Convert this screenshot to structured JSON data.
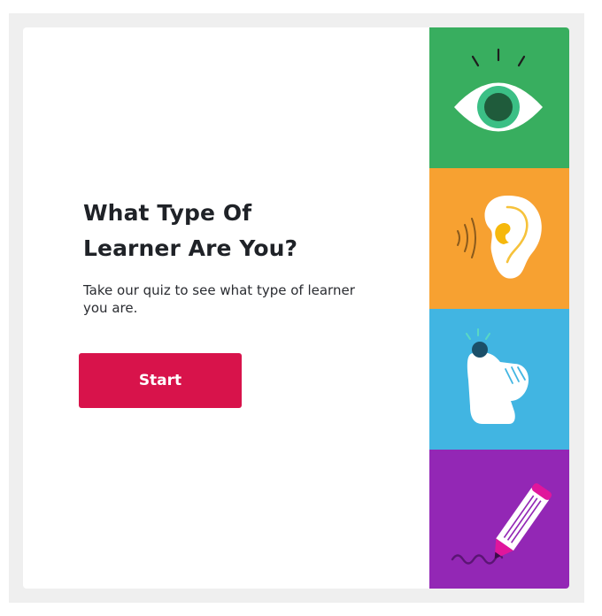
{
  "quiz": {
    "title_line1": "What Type Of",
    "title_line2": "Learner Are You?",
    "subtitle": "Take our quiz to see what type of learner you are.",
    "start_label": "Start"
  },
  "learner_types": [
    {
      "icon": "eye-icon",
      "color": "#38ae5f"
    },
    {
      "icon": "ear-icon",
      "color": "#f7a131"
    },
    {
      "icon": "hand-touch-icon",
      "color": "#41b5e2"
    },
    {
      "icon": "pencil-icon",
      "color": "#9327b5"
    }
  ],
  "colors": {
    "accent": "#d8134b",
    "background": "#efefef",
    "card": "#ffffff",
    "text": "#1f2227"
  }
}
